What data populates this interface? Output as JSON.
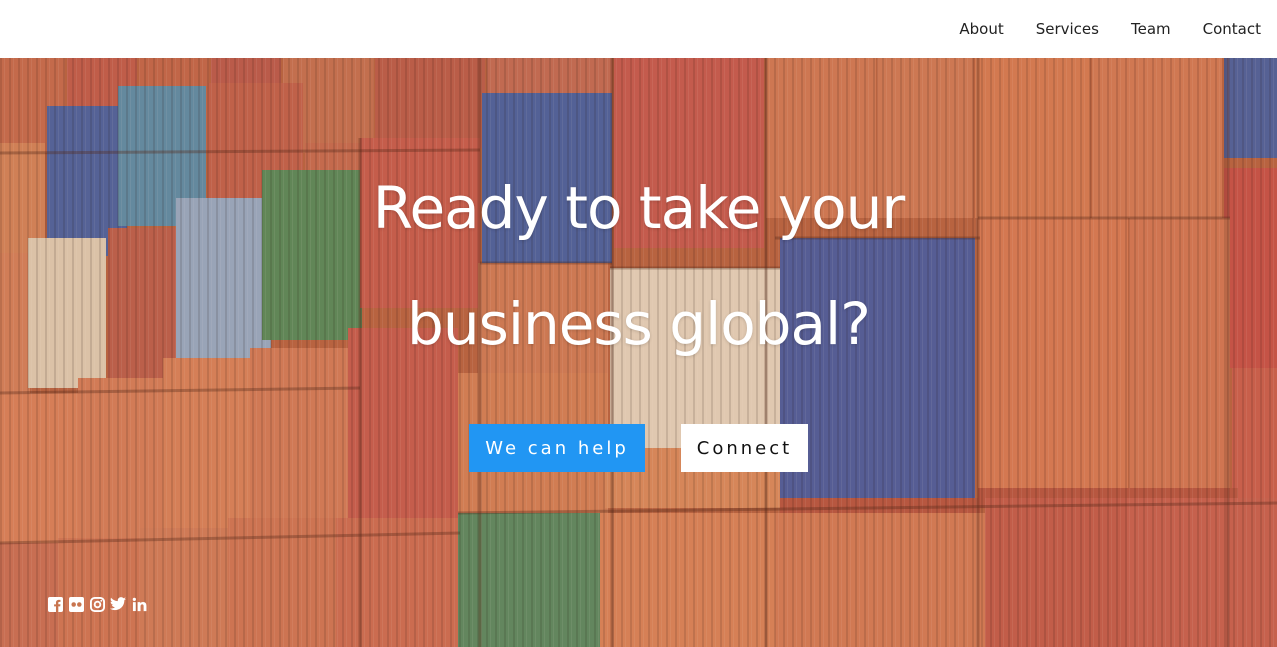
{
  "nav": {
    "items": [
      {
        "label": "About"
      },
      {
        "label": "Services"
      },
      {
        "label": "Team"
      },
      {
        "label": "Contact"
      }
    ]
  },
  "hero": {
    "headline_line1": "Ready to take your",
    "headline_line2": "business global?",
    "primary_button": "We can help",
    "secondary_button": "Connect",
    "accent_color": "#2196f3"
  },
  "social": {
    "icons": [
      "facebook-icon",
      "flickr-icon",
      "instagram-icon",
      "twitter-icon",
      "linkedin-icon"
    ]
  }
}
